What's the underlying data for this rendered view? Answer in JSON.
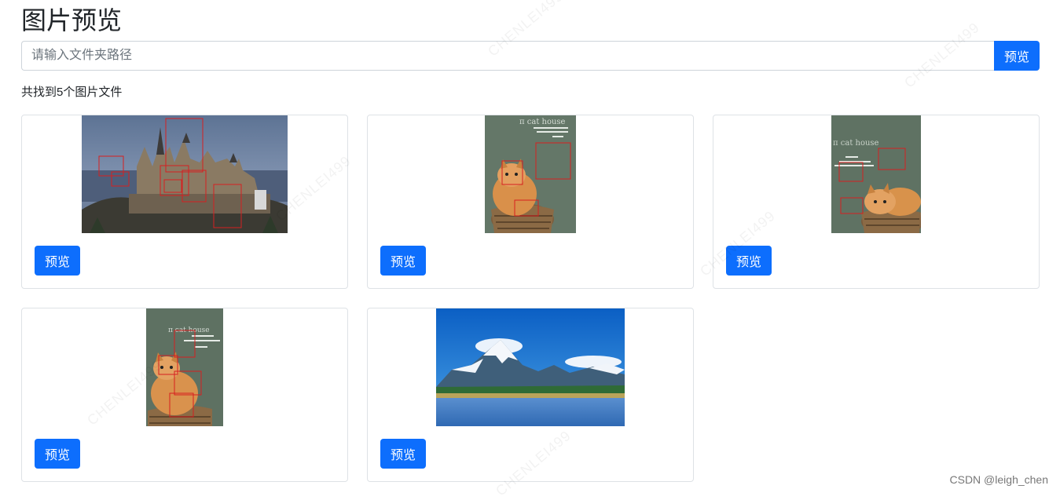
{
  "page": {
    "title": "图片预览",
    "search_placeholder": "请输入文件夹路径",
    "search_button": "预览",
    "result_text": "共找到5个图片文件",
    "watermark_text": "CHENLEI499",
    "footer_credit": "CSDN @leigh_chen"
  },
  "cards": [
    {
      "id": "castle",
      "button": "预览",
      "image_type": "castle",
      "detection_box_color": "#d62020"
    },
    {
      "id": "cat1",
      "button": "预览",
      "image_type": "cat-basket",
      "overlay_text": "π cat house",
      "detection_box_color": "#d62020"
    },
    {
      "id": "cat2",
      "button": "预览",
      "image_type": "cat-basket",
      "overlay_text": "π cat house",
      "detection_box_color": "#d62020"
    },
    {
      "id": "cat3",
      "button": "预览",
      "image_type": "cat-basket",
      "overlay_text": "π cat house",
      "detection_box_color": "#d62020"
    },
    {
      "id": "mountain",
      "button": "预览",
      "image_type": "mountain-lake"
    }
  ],
  "colors": {
    "primary": "#0d6efd",
    "border": "#dee2e6"
  }
}
